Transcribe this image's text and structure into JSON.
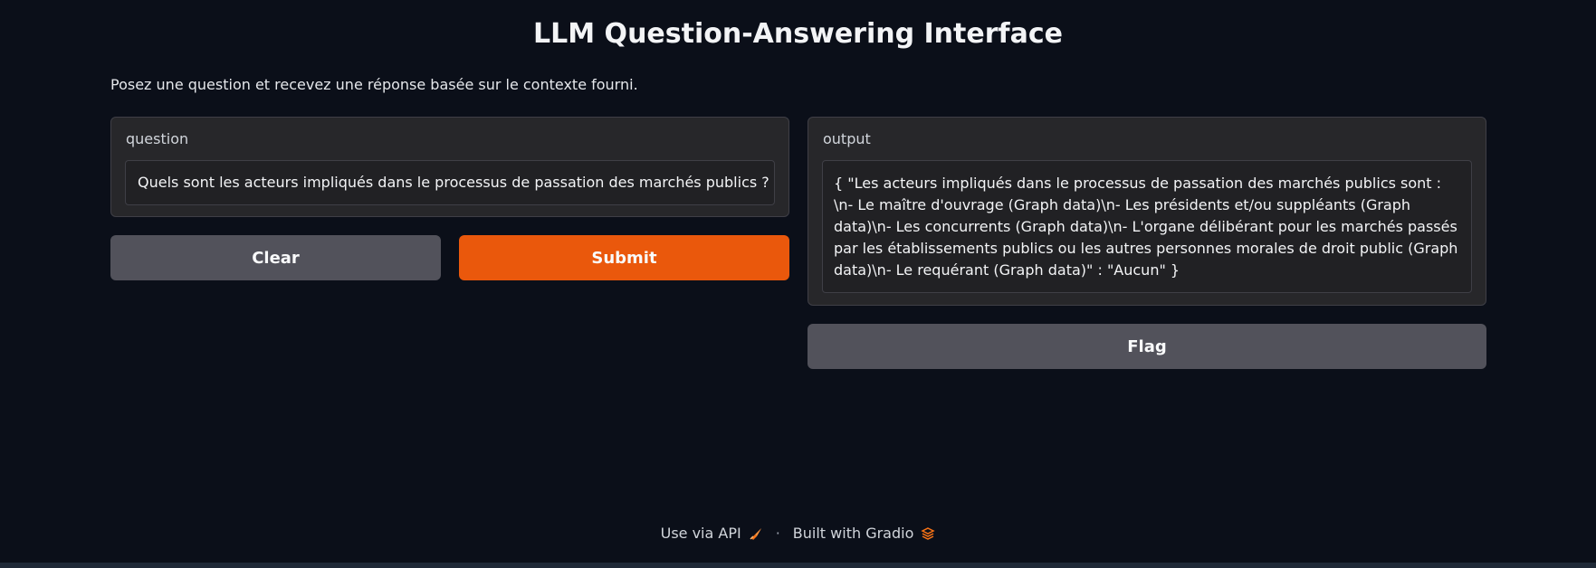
{
  "header": {
    "title": "LLM Question-Answering Interface",
    "description": "Posez une question et recevez une réponse basée sur le contexte fourni."
  },
  "question": {
    "label": "question",
    "value": "Quels sont les acteurs impliqués dans le processus de passation des marchés publics ?"
  },
  "output": {
    "label": "output",
    "value": "{ \"Les acteurs impliqués dans le processus de passation des marchés publics sont : \\n- Le maître d'ouvrage (Graph data)\\n- Les présidents et/ou suppléants (Graph data)\\n- Les concurrents (Graph data)\\n- L'organe délibérant pour les marchés passés par les établissements publics ou les autres personnes morales de droit public (Graph data)\\n- Le requérant (Graph data)\"  : \"Aucun\" }"
  },
  "buttons": {
    "clear": "Clear",
    "submit": "Submit",
    "flag": "Flag"
  },
  "footer": {
    "api_link": "Use via API",
    "separator": "·",
    "built_with": "Built with Gradio"
  },
  "colors": {
    "background": "#0b0f19",
    "panel": "#27272a",
    "primary": "#ea580c",
    "secondary": "#52525b"
  }
}
